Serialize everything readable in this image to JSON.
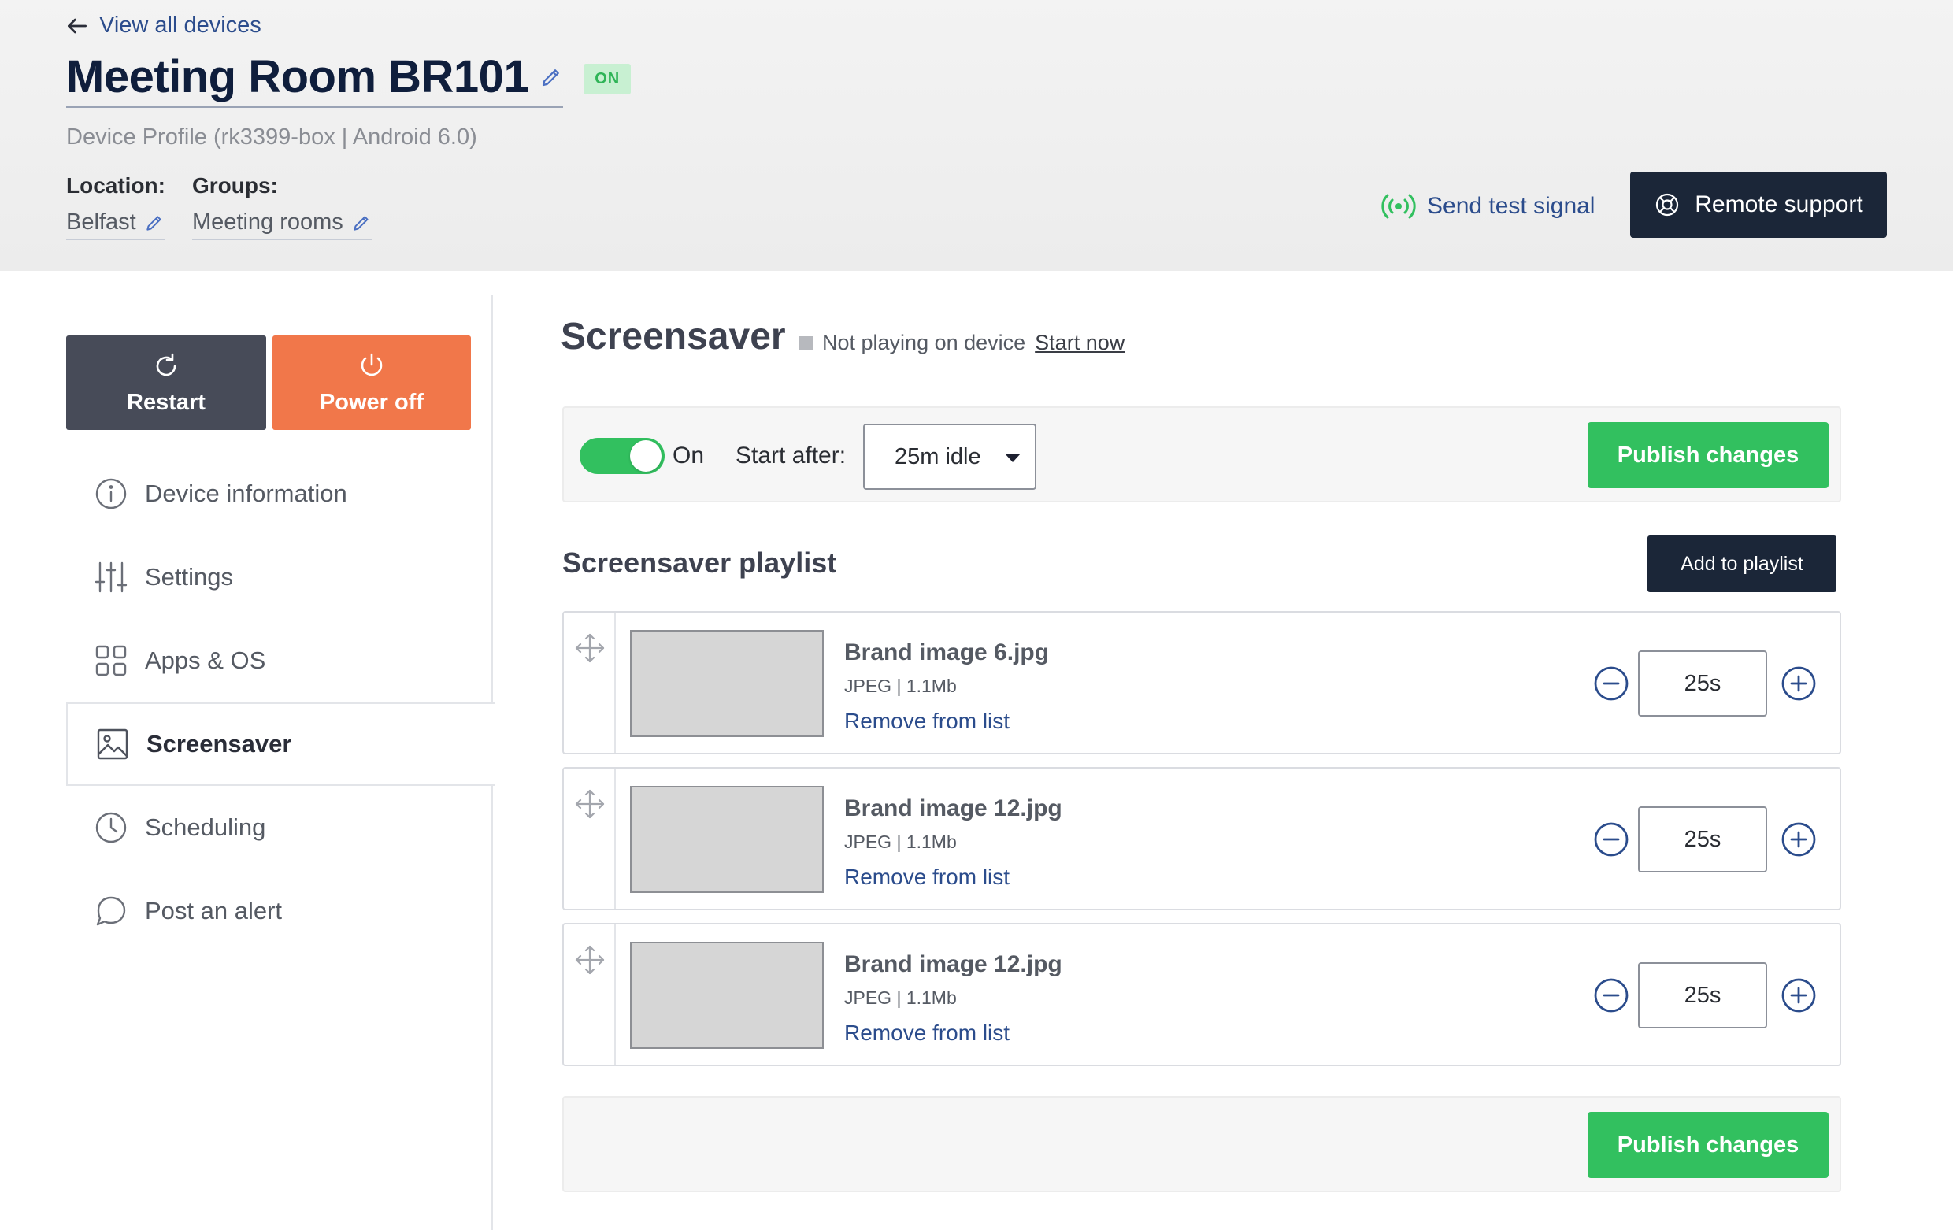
{
  "header": {
    "back_label": "View all devices",
    "title": "Meeting Room BR101",
    "status_badge": "ON",
    "profile": "Device Profile (rk3399-box | Android 6.0)",
    "location_label": "Location:",
    "location_value": "Belfast",
    "groups_label": "Groups:",
    "groups_value": "Meeting rooms",
    "test_signal_label": "Send test signal",
    "remote_support_label": "Remote support"
  },
  "sidebar": {
    "restart_label": "Restart",
    "power_off_label": "Power off",
    "items": [
      {
        "label": "Device information",
        "icon": "info-icon"
      },
      {
        "label": "Settings",
        "icon": "sliders-icon"
      },
      {
        "label": "Apps & OS",
        "icon": "apps-grid-icon"
      },
      {
        "label": "Screensaver",
        "icon": "image-icon",
        "active": true
      },
      {
        "label": "Scheduling",
        "icon": "clock-icon"
      },
      {
        "label": "Post an alert",
        "icon": "chat-bubble-icon"
      }
    ]
  },
  "main": {
    "title": "Screensaver",
    "status_text": "Not playing on device",
    "start_now_label": "Start now",
    "toggle_label": "On",
    "start_after_label": "Start after:",
    "start_after_value": "25m idle",
    "publish_label": "Publish changes",
    "playlist_title": "Screensaver playlist",
    "add_to_playlist_label": "Add to playlist",
    "playlist": [
      {
        "name": "Brand image 6.jpg",
        "meta": "JPEG | 1.1Mb",
        "remove_label": "Remove from list",
        "duration": "25s"
      },
      {
        "name": "Brand image 12.jpg",
        "meta": "JPEG | 1.1Mb",
        "remove_label": "Remove from list",
        "duration": "25s"
      },
      {
        "name": "Brand image 12.jpg",
        "meta": "JPEG | 1.1Mb",
        "remove_label": "Remove from list",
        "duration": "25s"
      }
    ]
  },
  "colors": {
    "accent_green": "#32c05f",
    "dark_navy": "#1b2638",
    "power_orange": "#f1774a",
    "link_blue": "#2b4c8c"
  }
}
